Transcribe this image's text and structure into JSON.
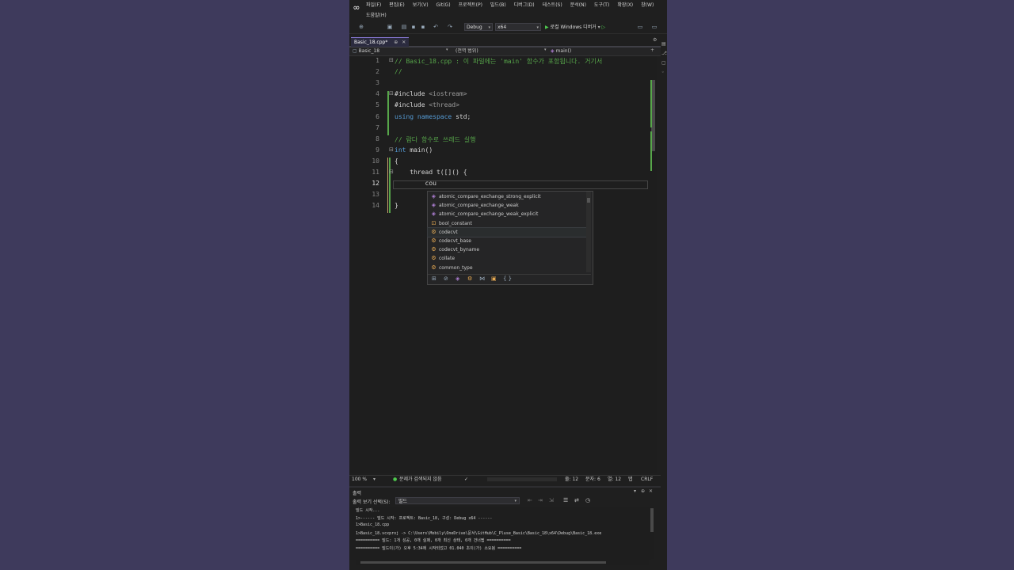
{
  "menubar": {
    "items": [
      "파일(F)",
      "편집(E)",
      "보기(V)",
      "Git(G)",
      "프로젝트(P)",
      "빌드(B)",
      "디버그(D)",
      "테스트(S)",
      "분석(N)",
      "도구(T)",
      "확장(X)",
      "창(W)"
    ],
    "second_row": "도움말(H)"
  },
  "toolbar": {
    "config": "Debug",
    "platform": "x64",
    "run_label": "로컬 Windows 디버거"
  },
  "tab": {
    "title": "Basic_18.cpp*",
    "pin": "⊕",
    "close": "✕"
  },
  "navbar": {
    "project": "Basic_18",
    "scope": "(전역 범위)",
    "member": "main()"
  },
  "editor": {
    "line_numbers": [
      "1",
      "2",
      "3",
      "4",
      "5",
      "6",
      "7",
      "8",
      "9",
      "10",
      "11",
      "12",
      "13",
      "14"
    ],
    "active_line": "12",
    "lines": [
      {
        "parts": [
          {
            "c": "cm",
            "t": "// Basic_18.cpp : 이 파일에는 'main' 함수가 포함됩니다. 거기서"
          }
        ]
      },
      {
        "parts": [
          {
            "c": "cm",
            "t": "//"
          }
        ]
      },
      {
        "parts": []
      },
      {
        "parts": [
          {
            "c": "",
            "t": "#include "
          },
          {
            "c": "inc",
            "t": "<iostream>"
          }
        ]
      },
      {
        "parts": [
          {
            "c": "",
            "t": "#include "
          },
          {
            "c": "inc",
            "t": "<thread>"
          }
        ]
      },
      {
        "parts": [
          {
            "c": "kw",
            "t": "using namespace"
          },
          {
            "c": "",
            "t": " std;"
          }
        ]
      },
      {
        "parts": []
      },
      {
        "parts": [
          {
            "c": "cm",
            "t": "// 람다 함수로 쓰레드 실행"
          }
        ]
      },
      {
        "parts": [
          {
            "c": "kw",
            "t": "int"
          },
          {
            "c": "",
            "t": " main()"
          }
        ]
      },
      {
        "parts": [
          {
            "c": "",
            "t": "{"
          }
        ]
      },
      {
        "parts": [
          {
            "c": "",
            "t": "    thread t([]() {"
          }
        ]
      },
      {
        "parts": [
          {
            "c": "",
            "t": "        cou"
          }
        ]
      },
      {
        "parts": []
      },
      {
        "parts": [
          {
            "c": "",
            "t": "}"
          }
        ]
      }
    ]
  },
  "autocomplete": {
    "items": [
      {
        "label": "atomic_compare_exchange_strong_explicit",
        "kind": "function"
      },
      {
        "label": "atomic_compare_exchange_weak",
        "kind": "function"
      },
      {
        "label": "atomic_compare_exchange_weak_explicit",
        "kind": "function"
      },
      {
        "label": "bool_constant",
        "kind": "typedef"
      },
      {
        "label": "codecvt",
        "kind": "class"
      },
      {
        "label": "codecvt_base",
        "kind": "class"
      },
      {
        "label": "codecvt_byname",
        "kind": "class"
      },
      {
        "label": "collate",
        "kind": "class"
      },
      {
        "label": "common_type",
        "kind": "class"
      }
    ],
    "selected_index": 4
  },
  "statusbar": {
    "zoom": "100 %",
    "issues": "문제가 검색되지 않음",
    "line": "줄: 12",
    "char": "문자: 6",
    "col": "열: 12",
    "tab": "탭",
    "eol": "CRLF"
  },
  "output": {
    "title": "출력",
    "source_label": "출력 보기 선택(S):",
    "source_value": "빌드",
    "lines": [
      "빌드 시작...",
      "1>------ 빌드 시작: 프로젝트: Basic_18, 구성: Debug x64 ------",
      "1>Basic_18.cpp",
      "1>Basic_18.vcxproj -> C:\\Users\\Mobily\\OneDrive\\문서\\GitHub\\C_Pluse_Basic\\Basic_18\\x64\\Debug\\Basic_18.exe",
      "========== 빌드: 1개 성공, 0개 실패, 0개 최신 상태, 0개 건너뜀 ==========",
      "========== 빌드이(가) 오후 5:34에 시작되었고 01.040 초이(가) 소요됨 =========="
    ]
  },
  "colors": {
    "background": "#3e3a5c",
    "ide_bg": "#1f1f1f",
    "comment": "#57a64a",
    "keyword": "#569cd6"
  }
}
